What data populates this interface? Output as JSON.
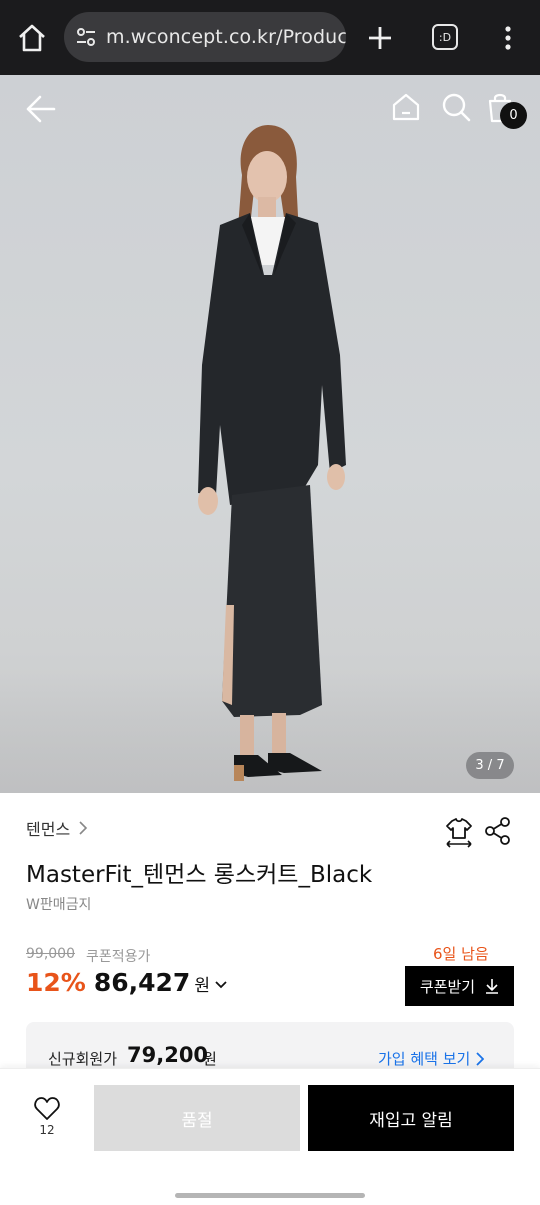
{
  "browser": {
    "url": "m.wconcept.co.kr/Product/",
    "tabs_label": ":D"
  },
  "gallery": {
    "pager": "3 / 7",
    "cart_count": "0",
    "image_alt": "model wearing black jacket and long skirt"
  },
  "product": {
    "brand": "텐먼스",
    "title": "MasterFit_텐먼스 롱스커트_Black",
    "sale_note": "W판매금지",
    "original_price": "99,000",
    "coupon_label": "쿠폰적용가",
    "days_left": "6일 남음",
    "discount": "12%",
    "price": "86,427",
    "currency": "원",
    "coupon_button": "쿠폰받기"
  },
  "member": {
    "label": "신규회원가",
    "price": "79,200",
    "currency": "원",
    "benefit_link": "가입 혜택 보기"
  },
  "bottom_bar": {
    "wish_count": "12",
    "soldout_label": "품절",
    "restock_label": "재입고 알림"
  },
  "colors": {
    "accent_orange": "#e8541a",
    "link_blue": "#1a73e8",
    "button_black": "#000000",
    "soldout_gray": "#dcdcdc"
  }
}
